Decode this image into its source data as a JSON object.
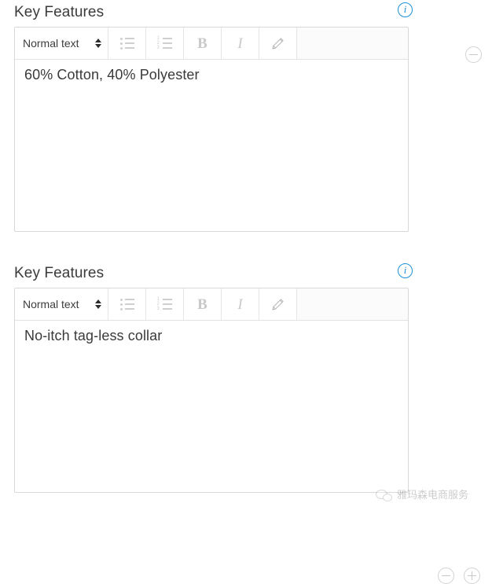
{
  "sections": [
    {
      "label": "Key Features",
      "info_icon": "info-circle-icon",
      "toolbar": {
        "style_select_value": "Normal text",
        "buttons": [
          {
            "name": "unordered-list",
            "glyph": "bullet-list-icon"
          },
          {
            "name": "ordered-list",
            "glyph": "numbered-list-icon"
          },
          {
            "name": "bold",
            "glyph": "B"
          },
          {
            "name": "italic",
            "glyph": "I"
          },
          {
            "name": "edit-source",
            "glyph": "pencil-icon"
          }
        ]
      },
      "content": "60% Cotton, 40% Polyester",
      "controls": [
        {
          "name": "remove-row-button",
          "glyph": "minus-circle-icon"
        }
      ]
    },
    {
      "label": "Key Features",
      "info_icon": "info-circle-icon",
      "toolbar": {
        "style_select_value": "Normal text",
        "buttons": [
          {
            "name": "unordered-list",
            "glyph": "bullet-list-icon"
          },
          {
            "name": "ordered-list",
            "glyph": "numbered-list-icon"
          },
          {
            "name": "bold",
            "glyph": "B"
          },
          {
            "name": "italic",
            "glyph": "I"
          },
          {
            "name": "edit-source",
            "glyph": "pencil-icon"
          }
        ]
      },
      "content": "No-itch tag-less collar",
      "controls": [
        {
          "name": "remove-row-button",
          "glyph": "minus-circle-icon"
        },
        {
          "name": "add-row-button",
          "glyph": "plus-circle-icon"
        }
      ]
    }
  ],
  "watermark": {
    "text": "雅玛森电商服务",
    "icon": "wechat-icon"
  },
  "colors": {
    "info_blue": "#1c8fd6",
    "text": "#3a3a3a",
    "border": "#d8d8d8",
    "toolbar_icon": "#c9c9c9"
  }
}
